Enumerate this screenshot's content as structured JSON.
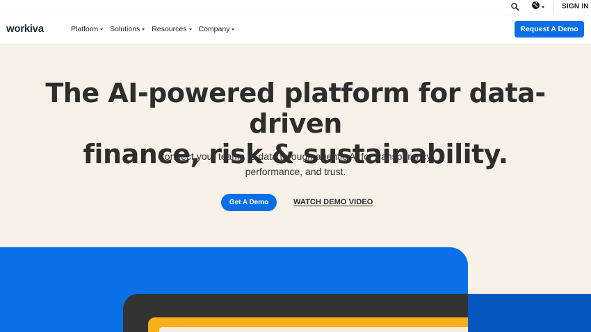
{
  "utility": {
    "search_icon": "search-icon",
    "globe_icon": "globe-icon",
    "signin_label": "SIGN IN"
  },
  "nav": {
    "logo": "workiva",
    "items": [
      {
        "label": "Platform"
      },
      {
        "label": "Solutions"
      },
      {
        "label": "Resources"
      },
      {
        "label": "Company"
      }
    ],
    "cta_label": "Request A Demo"
  },
  "hero": {
    "title_line1": "The AI-powered platform for data-driven",
    "title_line2": "finance, risk & sustainability.",
    "subtitle_line1": "Connect your teams to data through agentic AI for transparency,",
    "subtitle_line2": "performance, and trust.",
    "primary_button": "Get A Demo",
    "secondary_link": "WATCH DEMO VIDEO"
  },
  "colors": {
    "accent_blue": "#0a6fe6",
    "hero_bg": "#f8f1e7",
    "dark_blue": "#0557bd",
    "dark": "#333333",
    "yellow": "#fbb01a"
  }
}
